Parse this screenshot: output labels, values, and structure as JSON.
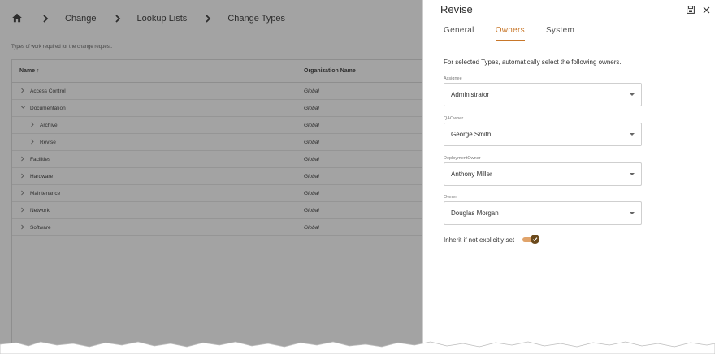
{
  "breadcrumb": {
    "home_icon": "home-icon",
    "items": [
      "Change",
      "Lookup Lists",
      "Change Types"
    ]
  },
  "description": "Types of work required for the change request.",
  "grid": {
    "columns": [
      "Name ↑",
      "Organization Name"
    ],
    "rows": [
      {
        "name": "Access Control",
        "org": "Global",
        "expanded": false,
        "indent": 0
      },
      {
        "name": "Documentation",
        "org": "Global",
        "expanded": true,
        "indent": 0
      },
      {
        "name": "Archive",
        "org": "Global",
        "expanded": false,
        "indent": 1
      },
      {
        "name": "Revise",
        "org": "Global",
        "expanded": false,
        "indent": 1
      },
      {
        "name": "Facilities",
        "org": "Global",
        "expanded": false,
        "indent": 0
      },
      {
        "name": "Hardware",
        "org": "Global",
        "expanded": false,
        "indent": 0
      },
      {
        "name": "Maintenance",
        "org": "Global",
        "expanded": false,
        "indent": 0
      },
      {
        "name": "Network",
        "org": "Global",
        "expanded": false,
        "indent": 0
      },
      {
        "name": "Software",
        "org": "Global",
        "expanded": false,
        "indent": 0
      }
    ]
  },
  "panel": {
    "title": "Revise",
    "tabs": [
      "General",
      "Owners",
      "System"
    ],
    "active_tab": "Owners",
    "intro": "For selected Types, automatically select the following owners.",
    "fields": [
      {
        "label": "Assignee",
        "value": "Administrator"
      },
      {
        "label": "QAOwner",
        "value": "George Smith"
      },
      {
        "label": "DeploymentOwner",
        "value": "Anthony Miller"
      },
      {
        "label": "Owner",
        "value": "Douglas Morgan"
      }
    ],
    "inherit_label": "Inherit if not explicitly set",
    "inherit_on": true
  },
  "colors": {
    "accent": "#c8772a",
    "toggle_track": "#e0a36a",
    "toggle_knob": "#6b4a1d"
  }
}
